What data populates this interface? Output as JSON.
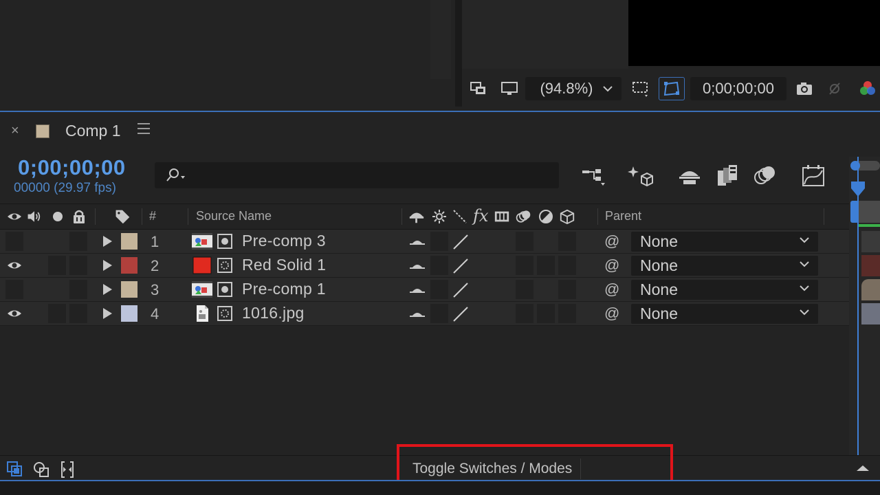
{
  "viewer": {
    "zoom_label": "(94.8%)",
    "timecode": "0;00;00;00"
  },
  "comp_tab": {
    "title": "Comp 1",
    "swatch_color": "#c4b49a"
  },
  "timeline": {
    "current_time": "0;00;00;00",
    "frame_info": "00000 (29.97 fps)",
    "search_placeholder": ""
  },
  "columns": {
    "number": "#",
    "source_name": "Source Name",
    "parent": "Parent"
  },
  "layers": [
    {
      "number": "1",
      "name": "Pre-comp 3",
      "label_color": "#c4b49a",
      "type": "precomp",
      "visible": false,
      "parent": "None"
    },
    {
      "number": "2",
      "name": "Red Solid 1",
      "label_color": "#b1403c",
      "type": "solid",
      "visible": true,
      "parent": "None"
    },
    {
      "number": "3",
      "name": "Pre-comp 1",
      "label_color": "#c4b49a",
      "type": "precomp",
      "visible": false,
      "parent": "None"
    },
    {
      "number": "4",
      "name": "1016.jpg",
      "label_color": "#bcc4dc",
      "type": "footage",
      "visible": true,
      "parent": "None"
    }
  ],
  "bottom_bar": {
    "toggle_label": "Toggle Switches / Modes"
  },
  "colors": {
    "accent_blue": "#5a9be6",
    "highlight_red": "#e0141a",
    "solid_red": "#e02a1f"
  }
}
